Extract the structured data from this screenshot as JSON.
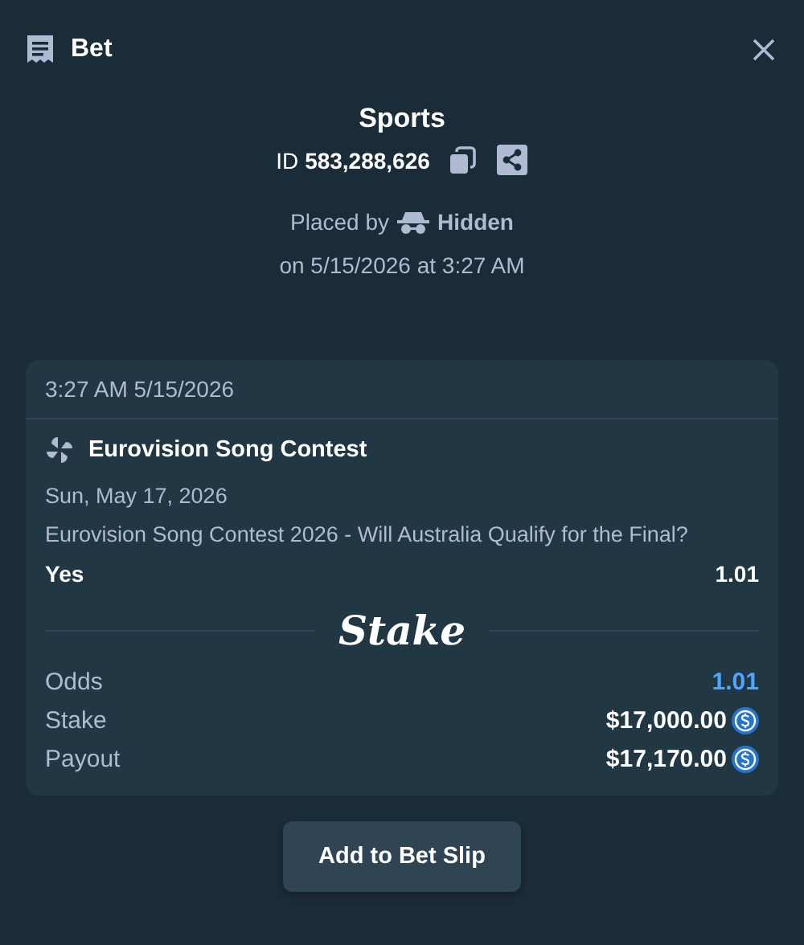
{
  "header": {
    "title": "Bet"
  },
  "summary": {
    "category": "Sports",
    "id_label": "ID",
    "id_value": "583,288,626",
    "placed_by_label": "Placed by",
    "placed_by_user": "Hidden",
    "placed_on": "on 5/15/2026 at 3:27 AM"
  },
  "card": {
    "timestamp": "3:27 AM 5/15/2026",
    "event": "Eurovision Song Contest",
    "date": "Sun, May 17, 2026",
    "market": "Eurovision Song Contest 2026 - Will Australia Qualify for the Final?",
    "outcome": "Yes",
    "outcome_odds": "1.01",
    "logo": "Stake",
    "rows": [
      {
        "label": "Odds",
        "value": "1.01",
        "kind": "odds"
      },
      {
        "label": "Stake",
        "value": "$17,000.00",
        "kind": "amount"
      },
      {
        "label": "Payout",
        "value": "$17,170.00",
        "kind": "amount"
      }
    ]
  },
  "action": {
    "label": "Add to Bet Slip"
  }
}
